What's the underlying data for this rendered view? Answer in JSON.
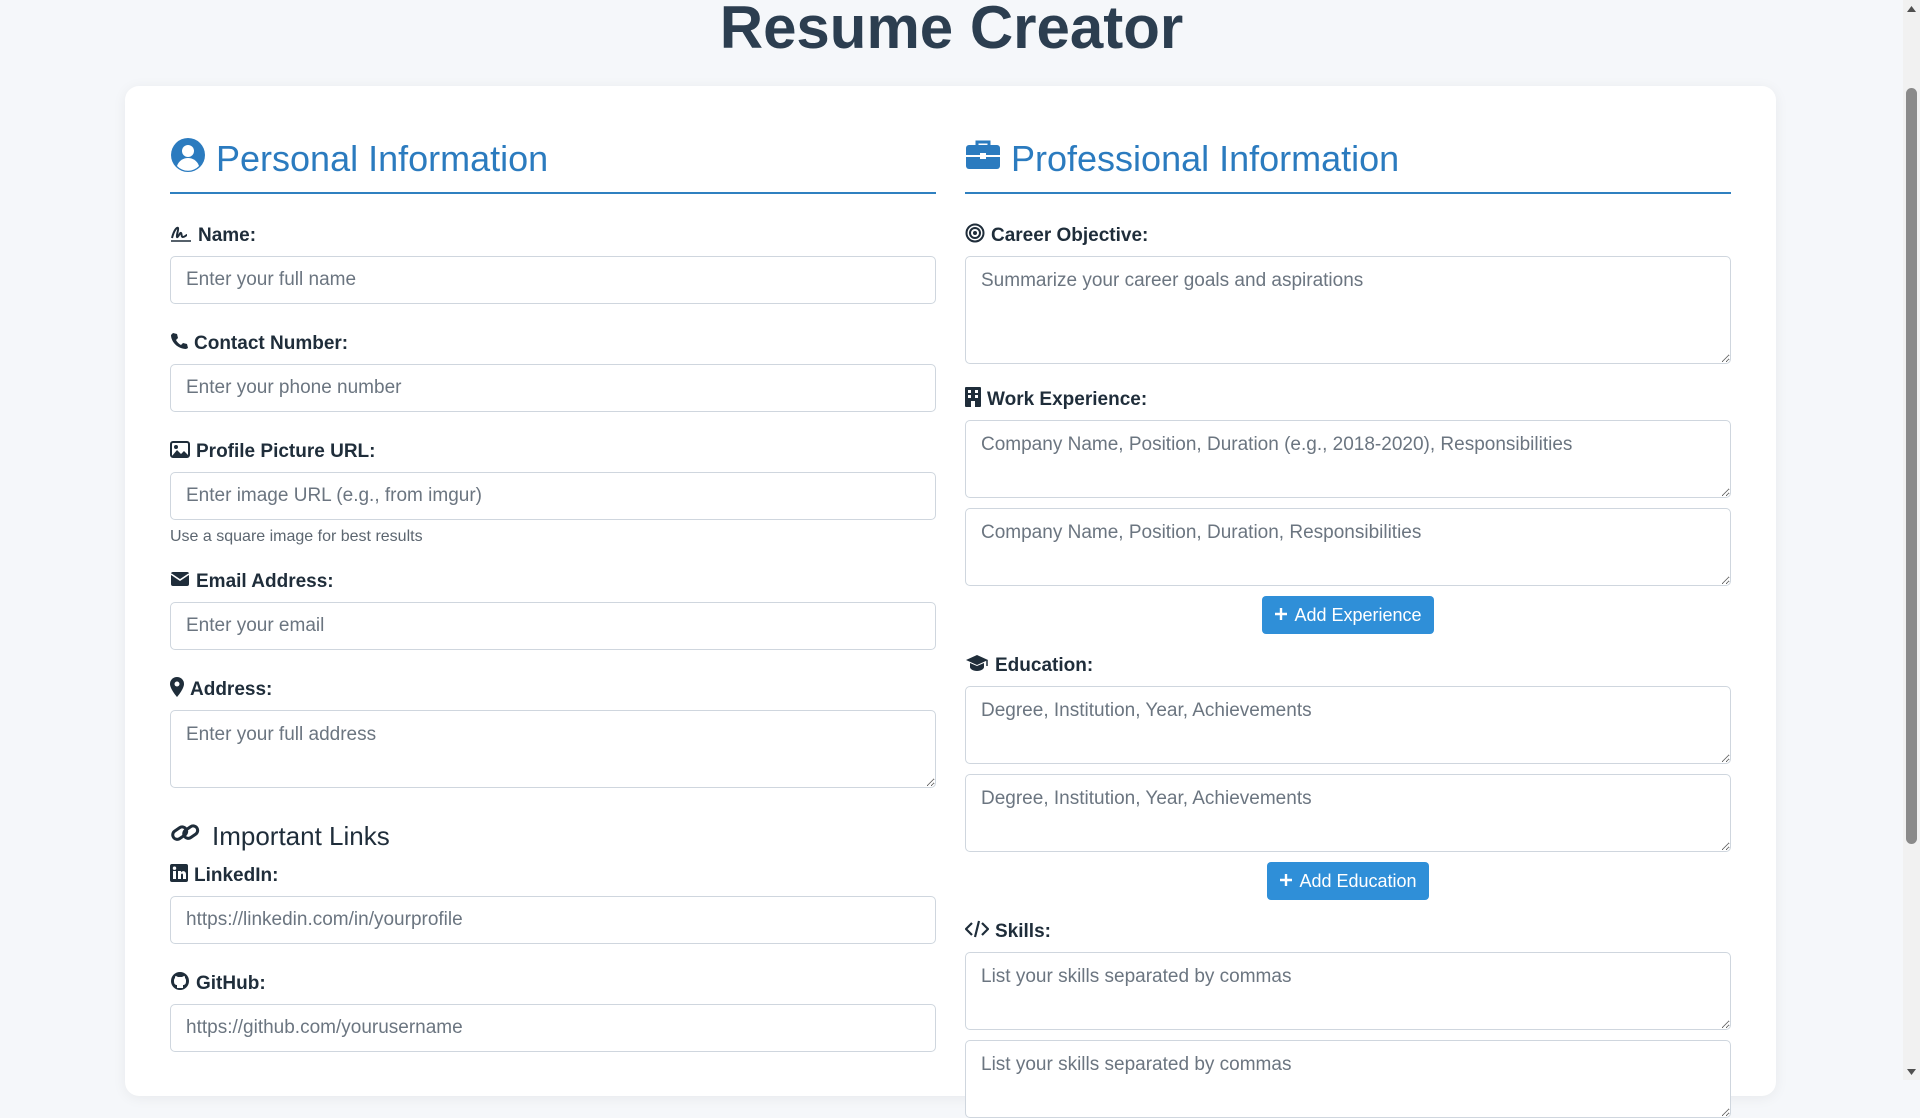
{
  "page_title": "Resume Creator",
  "personal": {
    "heading": "Personal Information",
    "name": {
      "label": "Name:",
      "placeholder": "Enter your full name"
    },
    "contact": {
      "label": "Contact Number:",
      "placeholder": "Enter your phone number"
    },
    "picture": {
      "label": "Profile Picture URL:",
      "placeholder": "Enter image URL (e.g., from imgur)",
      "hint": "Use a square image for best results"
    },
    "email": {
      "label": "Email Address:",
      "placeholder": "Enter your email"
    },
    "address": {
      "label": "Address:",
      "placeholder": "Enter your full address"
    },
    "links_heading": "Important Links",
    "linkedin": {
      "label": "LinkedIn:",
      "placeholder": "https://linkedin.com/in/yourprofile"
    },
    "github": {
      "label": "GitHub:",
      "placeholder": "https://github.com/yourusername"
    }
  },
  "professional": {
    "heading": "Professional Information",
    "objective": {
      "label": "Career Objective:",
      "placeholder": "Summarize your career goals and aspirations"
    },
    "experience": {
      "label": "Work Experience:",
      "placeholders": [
        "Company Name, Position, Duration (e.g., 2018-2020), Responsibilities",
        "Company Name, Position, Duration, Responsibilities"
      ],
      "add_label": "Add Experience"
    },
    "education": {
      "label": "Education:",
      "placeholders": [
        "Degree, Institution, Year, Achievements",
        "Degree, Institution, Year, Achievements"
      ],
      "add_label": "Add Education"
    },
    "skills": {
      "label": "Skills:",
      "placeholders": [
        "List your skills separated by commas",
        "List your skills separated by commas"
      ]
    }
  },
  "colors": {
    "accent": "#2b7bbf",
    "button": "#2f8fd8",
    "text": "#2c3e50",
    "background": "#f5f7fa"
  }
}
